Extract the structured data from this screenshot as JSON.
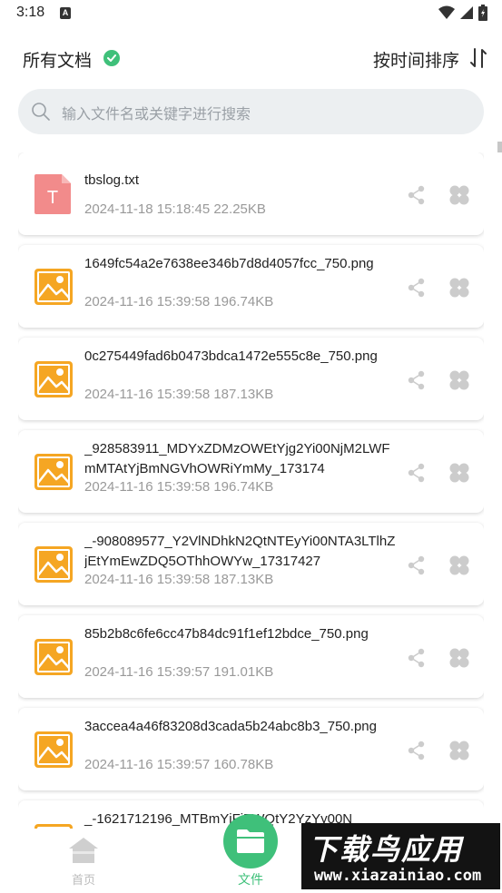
{
  "status_bar": {
    "time": "3:18",
    "notif_letter": "A"
  },
  "header": {
    "title": "所有文档",
    "sort_label": "按时间排序"
  },
  "search": {
    "placeholder": "输入文件名或关键字进行搜索"
  },
  "files": [
    {
      "name": "tbslog.txt",
      "date": "2024-11-18 15:18:45",
      "size": "22.25KB",
      "type": "txt",
      "type_letter": "T"
    },
    {
      "name": "1649fc54a2e7638ee346b7d8d4057fcc_750.png",
      "date": "2024-11-16 15:39:58",
      "size": "196.74KB",
      "type": "image"
    },
    {
      "name": "0c275449fad6b0473bdca1472e555c8e_750.png",
      "date": "2024-11-16 15:39:58",
      "size": "187.13KB",
      "type": "image"
    },
    {
      "name": "_928583911_MDYxZDMzOWEtYjg2Yi00NjM2LWFmMTAtYjBmNGVhOWRiYmMy_173174",
      "date": "2024-11-16 15:39:58",
      "size": "196.74KB",
      "type": "image"
    },
    {
      "name": "_-908089577_Y2VlNDhkN2QtNTEyYi00NTA3LTlhZjEtYmEwZDQ5OThhOWYw_17317427",
      "date": "2024-11-16 15:39:58",
      "size": "187.13KB",
      "type": "image"
    },
    {
      "name": "85b2b8c6fe6cc47b84dc91f1ef12bdce_750.png",
      "date": "2024-11-16 15:39:57",
      "size": "191.01KB",
      "type": "image"
    },
    {
      "name": "3accea4a46f83208d3cada5b24abc8b3_750.png",
      "date": "2024-11-16 15:39:57",
      "size": "160.78KB",
      "type": "image"
    },
    {
      "name": "_-1621712196_MTBmYjFiZWQtY2YzYy00N",
      "date": "",
      "size": "",
      "type": "image"
    }
  ],
  "bottom_nav": {
    "home_label": "首页",
    "files_label": "文件"
  },
  "watermark": {
    "text": "下载鸟应用",
    "url": "www.xiazainiao.com"
  },
  "colors": {
    "accent": "#3fc07a",
    "image_icon": "#f5a623",
    "txt_icon": "#f28b8b"
  }
}
